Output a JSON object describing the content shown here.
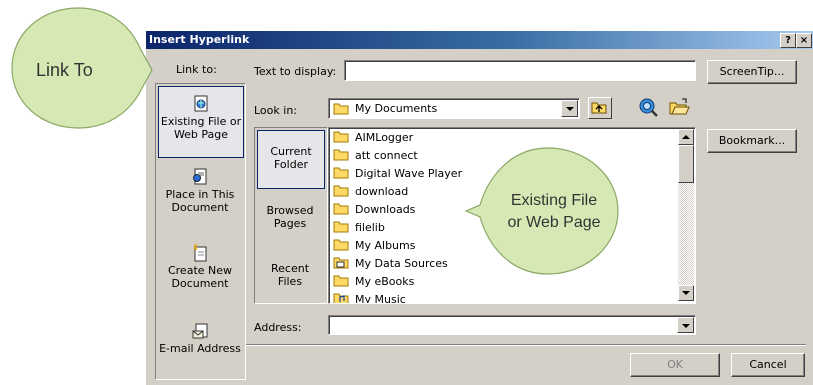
{
  "dialog": {
    "title": "Insert Hyperlink",
    "help_glyph": "?",
    "close_glyph": "×"
  },
  "rail": {
    "label_pre": "Link to:",
    "items": [
      {
        "line1": "Existing File or",
        "line2": "Web Page",
        "icon": "web-page-icon",
        "selected": true
      },
      {
        "line1": "Place in This",
        "line2": "Document",
        "icon": "place-in-document-icon"
      },
      {
        "line1": "Create New",
        "line2": "Document",
        "icon": "new-document-icon"
      },
      {
        "line1": "E-mail Address",
        "line2": "",
        "icon": "email-icon"
      }
    ]
  },
  "text_to_display": {
    "label": "Text to display:",
    "value": ""
  },
  "screentip_button": "ScreenTip...",
  "look_in": {
    "label": "Look in:",
    "value": "My Documents",
    "icon": "folder-icon"
  },
  "toolbar_icons": [
    "up-folder-icon",
    "search-web-icon",
    "open-folder-icon"
  ],
  "bookmark_button": "Bookmark...",
  "places": [
    {
      "line1": "Current",
      "line2": "Folder",
      "selected": true
    },
    {
      "line1": "Browsed",
      "line2": "Pages"
    },
    {
      "line1": "Recent",
      "line2": "Files"
    }
  ],
  "files": [
    {
      "name": "AIMLogger",
      "icon": "folder-icon"
    },
    {
      "name": "att connect",
      "icon": "folder-icon"
    },
    {
      "name": "Digital Wave Player",
      "icon": "folder-icon"
    },
    {
      "name": "download",
      "icon": "folder-icon"
    },
    {
      "name": "Downloads",
      "icon": "folder-icon"
    },
    {
      "name": "filelib",
      "icon": "folder-icon"
    },
    {
      "name": "My Albums",
      "icon": "folder-icon"
    },
    {
      "name": "My Data Sources",
      "icon": "data-source-folder-icon"
    },
    {
      "name": "My eBooks",
      "icon": "folder-icon"
    },
    {
      "name": "My Music",
      "icon": "music-folder-icon"
    }
  ],
  "address": {
    "label": "Address:",
    "value": ""
  },
  "ok_button": "OK",
  "cancel_button": "Cancel",
  "callouts": {
    "link_to": "Link To",
    "existing_line1": "Existing File",
    "existing_line2": "or Web Page"
  },
  "colors": {
    "callout_fill": "#d6e8b4",
    "callout_stroke": "#8aa866",
    "title_bar": "#0a246a",
    "dialog_face": "#d4d0c8"
  }
}
